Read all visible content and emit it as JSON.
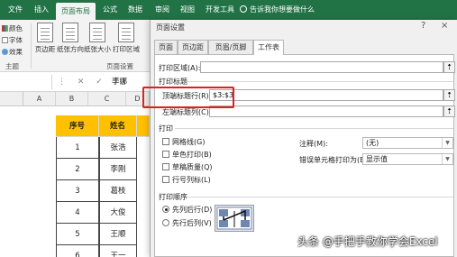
{
  "ribbon": {
    "tabs": [
      "文件",
      "插入",
      "页面布局",
      "公式",
      "数据",
      "审阅",
      "视图",
      "开发工具"
    ],
    "active_tab_index": 2,
    "tell_me": "告诉我你想要做什么"
  },
  "themes_group": {
    "items": [
      "颜色",
      "字体",
      "效果"
    ],
    "label": "主题"
  },
  "page_setup_group": {
    "buttons": [
      "页边距",
      "纸张方向",
      "纸张大小",
      "打印区域"
    ],
    "label": "页面设置"
  },
  "formula_bar": {
    "fx": "fx",
    "value": "李娜"
  },
  "sheet": {
    "columns": [
      "A",
      "B",
      "C",
      "D",
      "E"
    ],
    "header_row": [
      "序号",
      "姓名",
      ""
    ],
    "rows": [
      [
        "1",
        "张浩"
      ],
      [
        "2",
        "李刚"
      ],
      [
        "3",
        "葛枝"
      ],
      [
        "4",
        "大俊"
      ],
      [
        "5",
        "王顺"
      ],
      [
        "6",
        "王一"
      ]
    ]
  },
  "dialog": {
    "title": "页面设置",
    "help": "?",
    "close": "×",
    "tabs": [
      "页面",
      "页边距",
      "页眉/页脚",
      "工作表"
    ],
    "active_tab_index": 3,
    "print_area_label": "打印区域(A):",
    "print_titles_label": "打印标题",
    "top_rows_label": "顶端标题行(R):",
    "top_rows_value": "$3:$3",
    "left_cols_label": "左端标题列(C):",
    "left_cols_value": "",
    "print_label": "打印",
    "checkboxes": [
      "网格线(G)",
      "单色打印(B)",
      "草稿质量(Q)",
      "行号列标(L)"
    ],
    "comments_label": "注释(M):",
    "comments_value": "(无)",
    "errors_label": "错误单元格打印为(E):",
    "errors_value": "显示值",
    "page_order_label": "打印顺序",
    "radios": [
      "先列后行(D)",
      "先行后列(V)"
    ],
    "selected_radio_index": 0
  },
  "watermark": "头条 @手把手教你学会Excel"
}
